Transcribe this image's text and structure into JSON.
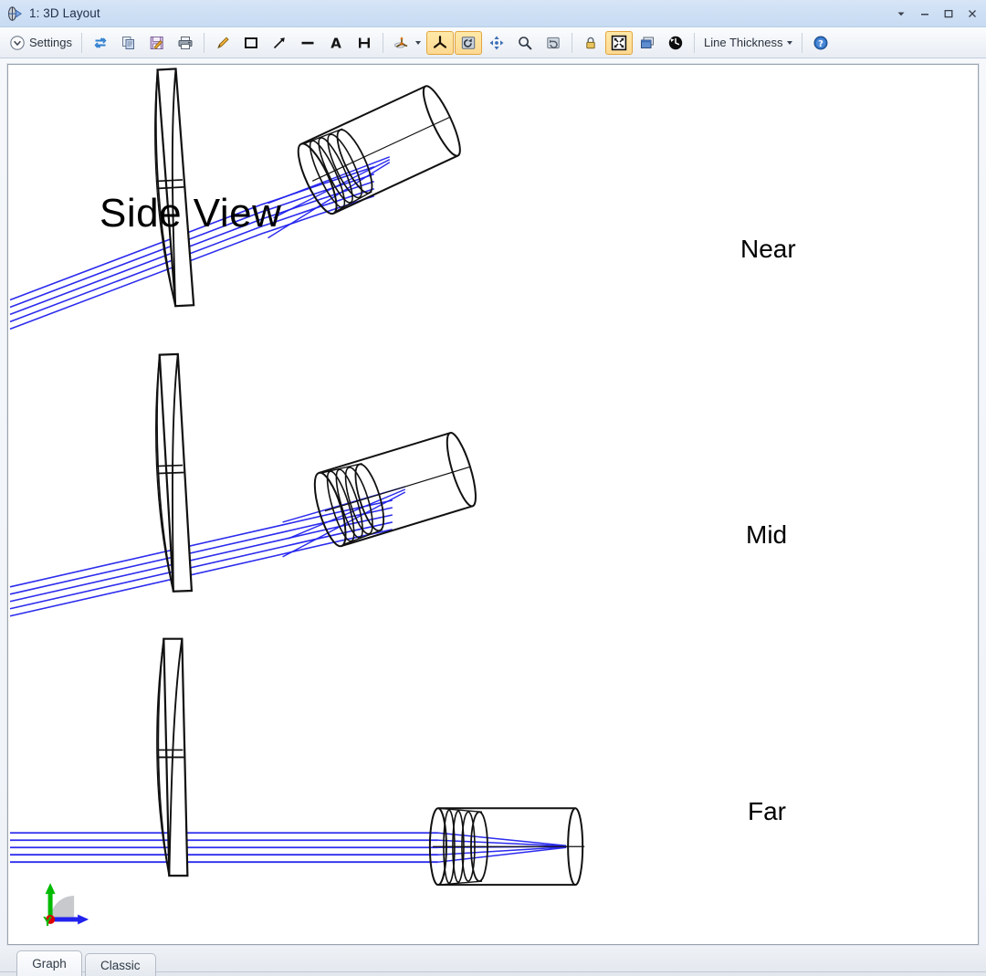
{
  "window": {
    "title": "1: 3D Layout",
    "icon": "lens-optics-icon",
    "controls": [
      {
        "name": "window-menu-button",
        "glyph": "▼"
      },
      {
        "name": "minimize-button",
        "glyph": "–"
      },
      {
        "name": "maximize-button",
        "glyph": "□"
      },
      {
        "name": "close-button",
        "glyph": "✕"
      }
    ]
  },
  "toolbar": {
    "settings_label": "Settings",
    "line_thickness_label": "Line Thickness",
    "items": [
      {
        "name": "settings-button",
        "icon": "chevron-down-circle-icon",
        "label": "Settings"
      },
      {
        "name": "refresh-button",
        "icon": "refresh-icon"
      },
      {
        "name": "copy-button",
        "icon": "copy-icon"
      },
      {
        "name": "save-button",
        "icon": "save-icon"
      },
      {
        "name": "print-button",
        "icon": "print-icon"
      },
      {
        "name": "annotate-pencil-button",
        "icon": "pencil-icon"
      },
      {
        "name": "draw-rectangle-button",
        "icon": "rectangle-icon"
      },
      {
        "name": "draw-arrow-button",
        "icon": "arrow-icon"
      },
      {
        "name": "draw-line-button",
        "icon": "line-icon"
      },
      {
        "name": "add-text-button",
        "icon": "text-a-icon"
      },
      {
        "name": "measure-button",
        "icon": "dimension-icon"
      },
      {
        "name": "view-orientation-button",
        "icon": "axes-3d-icon"
      },
      {
        "name": "show-axes-toggle",
        "icon": "tripod-axes-icon",
        "active": true
      },
      {
        "name": "rotate-tool-toggle",
        "icon": "rotate-view-icon",
        "active": true
      },
      {
        "name": "pan-tool-button",
        "icon": "pan-arrows-icon"
      },
      {
        "name": "zoom-tool-button",
        "icon": "magnifier-icon"
      },
      {
        "name": "reset-view-button",
        "icon": "undo-view-icon"
      },
      {
        "name": "lock-button",
        "icon": "lock-icon"
      },
      {
        "name": "fit-window-toggle",
        "icon": "fit-to-window-icon",
        "active": true
      },
      {
        "name": "detach-window-button",
        "icon": "windows-stack-icon"
      },
      {
        "name": "refresh-clock-button",
        "icon": "clock-refresh-icon"
      },
      {
        "name": "line-thickness-dropdown",
        "icon": "dropdown-caret-icon",
        "label": "Line Thickness"
      },
      {
        "name": "help-button",
        "icon": "help-question-icon"
      }
    ]
  },
  "plot": {
    "title": "Side View",
    "configurations": [
      {
        "name": "near",
        "label": "Near"
      },
      {
        "name": "mid",
        "label": "Mid"
      },
      {
        "name": "far",
        "label": "Far"
      }
    ],
    "axis_indicator": {
      "y_label": "Y",
      "z_label": "Z",
      "y_color": "#00bb00",
      "z_color": "#2222ee",
      "origin_color": "#dd0000"
    },
    "ray_color": "#2020ee",
    "element_color": "#000000"
  },
  "tabs": [
    {
      "name": "tab-graph",
      "label": "Graph",
      "selected": true
    },
    {
      "name": "tab-classic",
      "label": "Classic",
      "selected": false
    }
  ]
}
